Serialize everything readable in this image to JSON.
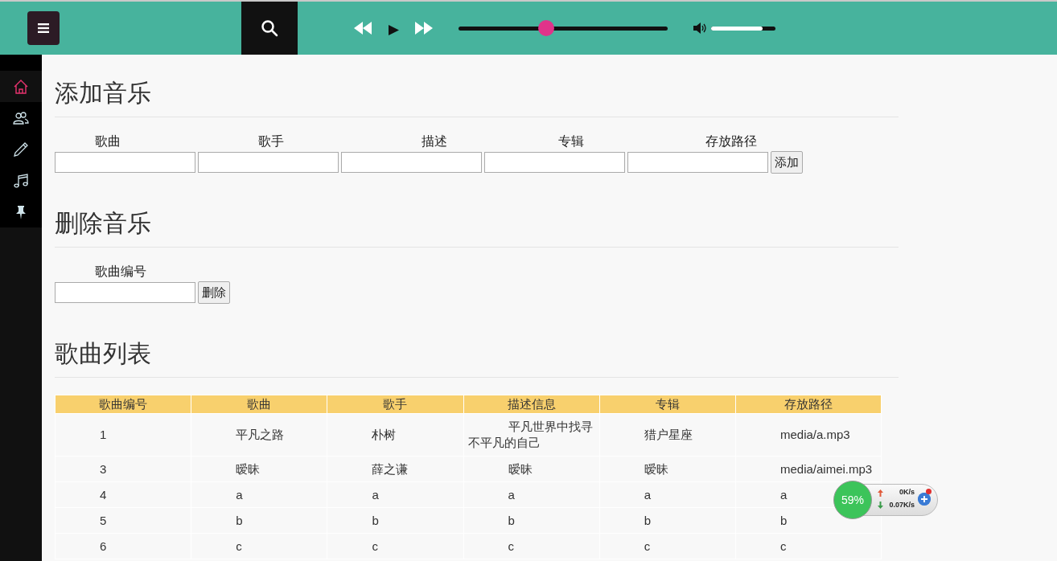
{
  "topbar": {
    "progress": {
      "level": 0.42
    },
    "volume": {
      "level": 0.8
    }
  },
  "sidebar": {
    "items": [
      {
        "kind": "home",
        "selected": true
      },
      {
        "kind": "users",
        "selected": false
      },
      {
        "kind": "pencil",
        "selected": false
      },
      {
        "kind": "music",
        "selected": false
      },
      {
        "kind": "pin",
        "selected": false
      }
    ]
  },
  "add_section": {
    "title": "添加音乐",
    "fields": [
      {
        "label": "歌曲"
      },
      {
        "label": "歌手"
      },
      {
        "label": "描述"
      },
      {
        "label": "专辑"
      },
      {
        "label": "存放路径"
      }
    ],
    "button": "添加"
  },
  "delete_section": {
    "title": "删除音乐",
    "fields": [
      {
        "label": "歌曲编号"
      }
    ],
    "button": "删除"
  },
  "list_section": {
    "title": "歌曲列表",
    "table": {
      "columns": [
        "歌曲编号",
        "歌曲",
        "歌手",
        "描述信息",
        "专辑",
        "存放路径"
      ],
      "rows": [
        [
          "1",
          "平凡之路",
          "朴树",
          "平凡世界中找寻不平凡的自己",
          "猎户星座",
          "media/a.mp3"
        ],
        [
          "3",
          "暧昧",
          "薛之谦",
          "暧昧",
          "暧昧",
          "media/aimei.mp3"
        ],
        [
          "4",
          "a",
          "a",
          "a",
          "a",
          "a"
        ],
        [
          "5",
          "b",
          "b",
          "b",
          "b",
          "b"
        ],
        [
          "6",
          "c",
          "c",
          "c",
          "c",
          "c"
        ]
      ]
    }
  },
  "net_widget": {
    "percent": "59%",
    "upload": "0K/s",
    "download": "0.07K/s"
  }
}
